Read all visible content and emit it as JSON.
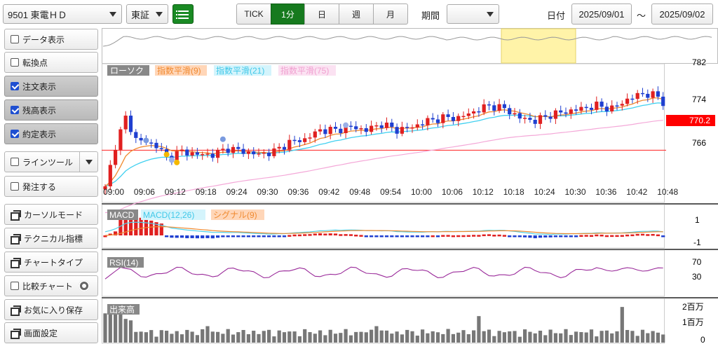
{
  "toolbar": {
    "stock": "9501 東電ＨＤ",
    "market": "東証",
    "intervals": [
      "TICK",
      "1分",
      "日",
      "週",
      "月"
    ],
    "active_interval": "1分",
    "period_label": "期間",
    "period_value": "",
    "date_label": "日付",
    "date_from": "2025/09/01",
    "date_sep": "〜",
    "date_to": "2025/09/02"
  },
  "sidebar": {
    "data_display": "データ表示",
    "pivot": "転換点",
    "order_display": "注文表示",
    "balance_display": "残高表示",
    "execution_display": "約定表示",
    "line_tool": "ラインツール",
    "order": "発注する",
    "cursor_mode": "カーソルモード",
    "technical": "テクニカル指標",
    "chart_type": "チャートタイプ",
    "compare": "比較チャート",
    "favorite": "お気に入り保存",
    "screen_settings": "画面設定"
  },
  "chart_data": {
    "type": "candlestick",
    "colors": {
      "up": "#e02020",
      "down": "#1f3fd0",
      "ema9": "#f08a30",
      "ema21": "#40d0f0",
      "ema75": "#f4a8d8",
      "macd": "#4fd0e8",
      "signal": "#f08a30",
      "rsi": "#9a2a9a",
      "volume": "#777777",
      "price_line": "#ff2020",
      "navigator": "#999999",
      "highlight": "#fff3a8"
    },
    "legend": {
      "candle": "ローソク",
      "ema9": "指数平滑(9)",
      "ema21": "指数平滑(21)",
      "ema75": "指数平滑(75)"
    },
    "price_axis": {
      "ticks": [
        "782",
        "774",
        "766"
      ],
      "ylim": [
        762,
        784
      ]
    },
    "current_price": "770.2",
    "x_labels": [
      "09:00",
      "09:06",
      "09:12",
      "09:18",
      "09:24",
      "09:30",
      "09:36",
      "09:42",
      "09:48",
      "09:54",
      "10:00",
      "10:06",
      "10:12",
      "10:18",
      "10:24",
      "10:30",
      "10:36",
      "10:42",
      "10:48"
    ],
    "macd_panel": {
      "labels": [
        "MACD",
        "MACD(12,26)",
        "シグナル(9)"
      ],
      "ticks": [
        "1",
        "-1"
      ]
    },
    "rsi_panel": {
      "label": "RSI(14)",
      "ticks": [
        "70",
        "30"
      ]
    },
    "volume_panel": {
      "label": "出来高",
      "ticks": [
        "2百万",
        "1百万",
        "0"
      ]
    },
    "anchors": {
      "times": [
        0,
        2,
        4,
        6,
        8,
        10,
        12,
        15,
        18,
        21,
        24,
        27,
        30,
        33,
        36,
        39,
        42,
        45,
        48,
        51,
        54,
        57,
        60,
        63,
        66,
        69,
        72,
        75,
        78,
        81,
        84,
        87,
        90,
        93,
        96,
        99,
        102,
        105,
        108,
        109
      ],
      "closes": [
        764.0,
        771.0,
        775.5,
        772.0,
        771.5,
        771.0,
        769.0,
        770.0,
        769.5,
        769.5,
        770.5,
        770.0,
        769.5,
        770.0,
        771.5,
        772.0,
        773.5,
        773.5,
        774.0,
        773.5,
        774.5,
        773.5,
        774.0,
        775.0,
        775.5,
        775.5,
        776.5,
        777.5,
        777.0,
        775.5,
        775.0,
        776.0,
        776.5,
        777.0,
        777.5,
        777.0,
        778.5,
        779.5,
        779.0,
        778.0
      ]
    }
  }
}
